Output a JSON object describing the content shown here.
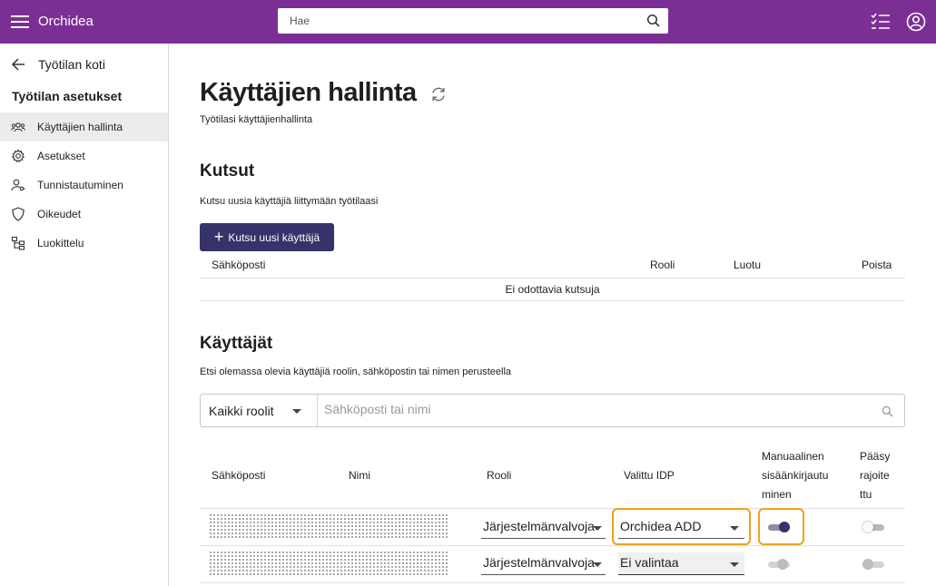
{
  "app": {
    "title": "Orchidea"
  },
  "search": {
    "placeholder": "Hae"
  },
  "sidebar": {
    "back_label": "Työtilan koti",
    "heading": "Työtilan asetukset",
    "items": [
      {
        "label": "Käyttäjien hallinta",
        "icon": "users-icon",
        "active": true
      },
      {
        "label": "Asetukset",
        "icon": "gear-icon"
      },
      {
        "label": "Tunnistautuminen",
        "icon": "user-key-icon"
      },
      {
        "label": "Oikeudet",
        "icon": "shield-icon"
      },
      {
        "label": "Luokittelu",
        "icon": "hierarchy-icon"
      }
    ]
  },
  "page": {
    "title": "Käyttäjien hallinta",
    "subtitle": "Työtilasi käyttäjienhallinta"
  },
  "invites": {
    "title": "Kutsut",
    "subtitle": "Kutsu uusia käyttäjiä liittymään työtilaasi",
    "button_label": "Kutsu uusi käyttäjä",
    "columns": [
      "Sähköposti",
      "Rooli",
      "Luotu",
      "Poista"
    ],
    "empty_text": "Ei odottavia kutsuja"
  },
  "users": {
    "title": "Käyttäjät",
    "subtitle": "Etsi olemassa olevia käyttäjiä roolin, sähköpostin tai nimen perusteella",
    "role_filter_value": "Kaikki roolit",
    "search_placeholder": "Sähköposti tai nimi",
    "columns": {
      "email": "Sähköposti",
      "name": "Nimi",
      "role": "Rooli",
      "idp": "Valittu IDP",
      "manual_login": [
        "Manuaalinen",
        "sisäänkirjautu",
        "minen"
      ],
      "restricted": [
        "Pääsy",
        "rajoite",
        "ttu"
      ]
    },
    "rows": [
      {
        "role": "Järjestelmänvalvoja",
        "idp": "Orchidea ADD",
        "manual_login": true,
        "restricted": false
      },
      {
        "role": "Järjestelmänvalvoja",
        "idp": "Ei valintaa",
        "manual_login": false,
        "restricted": false
      }
    ]
  },
  "colors": {
    "topbar": "#7b2f95",
    "primary_button": "#35336a",
    "highlight": "#f0a21b"
  }
}
